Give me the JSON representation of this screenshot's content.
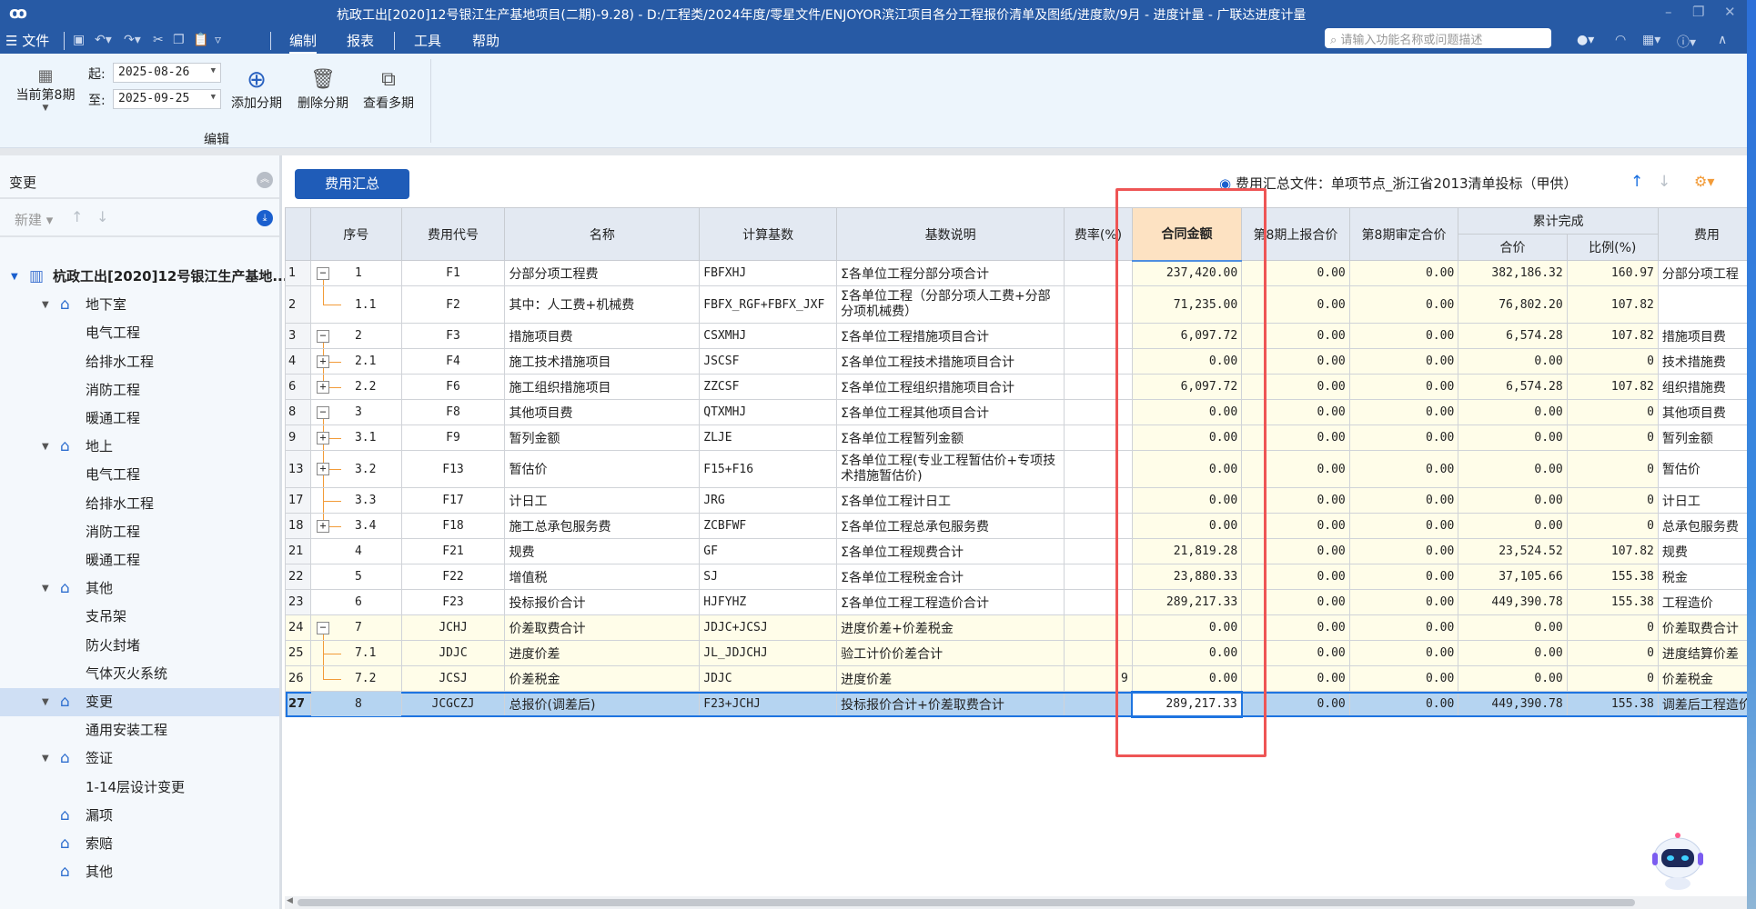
{
  "titlebar": {
    "title": "杭政工出[2020]12号银江生产基地项目(二期)-9.28) - D:/工程类/2024年度/零星文件/ENJOYOR滨江项目各分工程报价清单及图纸/进度款/9月 - 进度计量 - 广联达进度计量",
    "minimize": "–",
    "restore": "❐",
    "close": "✕"
  },
  "menubar": {
    "file": "☰ 文件",
    "tabs": [
      "编制",
      "报表",
      "工具",
      "帮助"
    ],
    "search_placeholder": "请输入功能名称或问题描述"
  },
  "ribbon": {
    "period_label": "当前第8期",
    "start_label": "起:",
    "start_date": "2025-08-26",
    "end_label": "至:",
    "end_date": "2025-09-25",
    "buttons": [
      "添加分期",
      "删除分期",
      "查看多期"
    ],
    "group_label": "编辑"
  },
  "sidebar": {
    "title": "变更",
    "new_label": "新建",
    "items": [
      {
        "label": "杭政工出[2020]12号银江生产基地...",
        "type": "root"
      },
      {
        "label": "地下室",
        "type": "group"
      },
      {
        "label": "电气工程",
        "type": "leaf"
      },
      {
        "label": "给排水工程",
        "type": "leaf"
      },
      {
        "label": "消防工程",
        "type": "leaf"
      },
      {
        "label": "暖通工程",
        "type": "leaf"
      },
      {
        "label": "地上",
        "type": "group"
      },
      {
        "label": "电气工程",
        "type": "leaf"
      },
      {
        "label": "给排水工程",
        "type": "leaf"
      },
      {
        "label": "消防工程",
        "type": "leaf"
      },
      {
        "label": "暖通工程",
        "type": "leaf"
      },
      {
        "label": "其他",
        "type": "group"
      },
      {
        "label": "支吊架",
        "type": "leaf"
      },
      {
        "label": "防火封堵",
        "type": "leaf"
      },
      {
        "label": "气体灭火系统",
        "type": "leaf"
      },
      {
        "label": "变更",
        "type": "group",
        "selected": true
      },
      {
        "label": "通用安装工程",
        "type": "leaf"
      },
      {
        "label": "签证",
        "type": "group"
      },
      {
        "label": "1-14层设计变更",
        "type": "leaf"
      },
      {
        "label": "漏项",
        "type": "single"
      },
      {
        "label": "索赔",
        "type": "single"
      },
      {
        "label": "其他",
        "type": "single"
      }
    ]
  },
  "main": {
    "summary_button": "费用汇总",
    "file_info": "费用汇总文件：单项节点_浙江省2013清单投标（甲供）",
    "headers": {
      "seq": "序号",
      "code": "费用代号",
      "name": "名称",
      "base": "计算基数",
      "desc": "基数说明",
      "rate": "费率(%)",
      "contract": "合同金额",
      "reported": "第8期上报合价",
      "approved": "第8期审定合价",
      "cumulative": "累计完成",
      "cum_total": "合价",
      "cum_ratio": "比例(%)",
      "fee_type": "费用"
    },
    "rows": [
      {
        "rn": "1",
        "seq": "1",
        "exp": "-",
        "code": "F1",
        "name": "分部分项工程费",
        "base": "FBFXHJ",
        "desc": "Σ各单位工程分部分项合计",
        "rate": "",
        "contract": "237,420.00",
        "reported": "0.00",
        "approved": "0.00",
        "cum_total": "382,186.32",
        "cum_ratio": "160.97",
        "fee_type": "分部分项工程"
      },
      {
        "rn": "2",
        "seq": "1.1",
        "branch": "last",
        "code": "F2",
        "name": "其中：人工费+机械费",
        "base": "FBFX_RGF+FBFX_JXF",
        "desc": "Σ各单位工程（分部分项人工费+分部分项机械费）",
        "rate": "",
        "contract": "71,235.00",
        "reported": "0.00",
        "approved": "0.00",
        "cum_total": "76,802.20",
        "cum_ratio": "107.82",
        "fee_type": "",
        "tall": true
      },
      {
        "rn": "3",
        "seq": "2",
        "exp": "-",
        "code": "F3",
        "name": "措施项目费",
        "base": "CSXMHJ",
        "desc": "Σ各单位工程措施项目合计",
        "rate": "",
        "contract": "6,097.72",
        "reported": "0.00",
        "approved": "0.00",
        "cum_total": "6,574.28",
        "cum_ratio": "107.82",
        "fee_type": "措施项目费"
      },
      {
        "rn": "4",
        "seq": "2.1",
        "exp": "+",
        "branch": "mid",
        "code": "F4",
        "name": "施工技术措施项目",
        "base": "JSCSF",
        "desc": "Σ各单位工程技术措施项目合计",
        "rate": "",
        "contract": "0.00",
        "reported": "0.00",
        "approved": "0.00",
        "cum_total": "0.00",
        "cum_ratio": "0",
        "fee_type": "技术措施费"
      },
      {
        "rn": "6",
        "seq": "2.2",
        "exp": "+",
        "branch": "last",
        "code": "F6",
        "name": "施工组织措施项目",
        "base": "ZZCSF",
        "desc": "Σ各单位工程组织措施项目合计",
        "rate": "",
        "contract": "6,097.72",
        "reported": "0.00",
        "approved": "0.00",
        "cum_total": "6,574.28",
        "cum_ratio": "107.82",
        "fee_type": "组织措施费"
      },
      {
        "rn": "8",
        "seq": "3",
        "exp": "-",
        "code": "F8",
        "name": "其他项目费",
        "base": "QTXMHJ",
        "desc": "Σ各单位工程其他项目合计",
        "rate": "",
        "contract": "0.00",
        "reported": "0.00",
        "approved": "0.00",
        "cum_total": "0.00",
        "cum_ratio": "0",
        "fee_type": "其他项目费"
      },
      {
        "rn": "9",
        "seq": "3.1",
        "exp": "+",
        "branch": "mid",
        "code": "F9",
        "name": "暂列金额",
        "base": "ZLJE",
        "desc": "Σ各单位工程暂列金额",
        "rate": "",
        "contract": "0.00",
        "reported": "0.00",
        "approved": "0.00",
        "cum_total": "0.00",
        "cum_ratio": "0",
        "fee_type": "暂列金额"
      },
      {
        "rn": "13",
        "seq": "3.2",
        "exp": "+",
        "branch": "mid",
        "code": "F13",
        "name": "暂估价",
        "base": "F15+F16",
        "desc": "Σ各单位工程(专业工程暂估价+专项技术措施暂估价)",
        "rate": "",
        "contract": "0.00",
        "reported": "0.00",
        "approved": "0.00",
        "cum_total": "0.00",
        "cum_ratio": "0",
        "fee_type": "暂估价",
        "tall": true
      },
      {
        "rn": "17",
        "seq": "3.3",
        "branch": "mid",
        "code": "F17",
        "name": "计日工",
        "base": "JRG",
        "desc": "Σ各单位工程计日工",
        "rate": "",
        "contract": "0.00",
        "reported": "0.00",
        "approved": "0.00",
        "cum_total": "0.00",
        "cum_ratio": "0",
        "fee_type": "计日工"
      },
      {
        "rn": "18",
        "seq": "3.4",
        "exp": "+",
        "branch": "last",
        "code": "F18",
        "name": "施工总承包服务费",
        "base": "ZCBFWF",
        "desc": "Σ各单位工程总承包服务费",
        "rate": "",
        "contract": "0.00",
        "reported": "0.00",
        "approved": "0.00",
        "cum_total": "0.00",
        "cum_ratio": "0",
        "fee_type": "总承包服务费"
      },
      {
        "rn": "21",
        "seq": "4",
        "code": "F21",
        "name": "规费",
        "base": "GF",
        "desc": "Σ各单位工程规费合计",
        "rate": "",
        "contract": "21,819.28",
        "reported": "0.00",
        "approved": "0.00",
        "cum_total": "23,524.52",
        "cum_ratio": "107.82",
        "fee_type": "规费"
      },
      {
        "rn": "22",
        "seq": "5",
        "code": "F22",
        "name": "增值税",
        "base": "SJ",
        "desc": "Σ各单位工程税金合计",
        "rate": "",
        "contract": "23,880.33",
        "reported": "0.00",
        "approved": "0.00",
        "cum_total": "37,105.66",
        "cum_ratio": "155.38",
        "fee_type": "税金"
      },
      {
        "rn": "23",
        "seq": "6",
        "code": "F23",
        "name": "投标报价合计",
        "base": "HJFYHZ",
        "desc": "Σ各单位工程工程造价合计",
        "rate": "",
        "contract": "289,217.33",
        "reported": "0.00",
        "approved": "0.00",
        "cum_total": "449,390.78",
        "cum_ratio": "155.38",
        "fee_type": "工程造价"
      },
      {
        "rn": "24",
        "seq": "7",
        "exp": "-",
        "code": "JCHJ",
        "name": "价差取费合计",
        "base": "JDJC+JCSJ",
        "desc": "进度价差+价差税金",
        "rate": "",
        "contract": "0.00",
        "reported": "0.00",
        "approved": "0.00",
        "cum_total": "0.00",
        "cum_ratio": "0",
        "fee_type": "价差取费合计",
        "yellow": true
      },
      {
        "rn": "25",
        "seq": "7.1",
        "branch": "mid",
        "code": "JDJC",
        "name": "进度价差",
        "base": "JL_JDJCHJ",
        "desc": "验工计价价差合计",
        "rate": "",
        "contract": "0.00",
        "reported": "0.00",
        "approved": "0.00",
        "cum_total": "0.00",
        "cum_ratio": "0",
        "fee_type": "进度结算价差",
        "yellow": true
      },
      {
        "rn": "26",
        "seq": "7.2",
        "branch": "last",
        "code": "JCSJ",
        "name": "价差税金",
        "base": "JDJC",
        "desc": "进度价差",
        "rate": "9",
        "contract": "0.00",
        "reported": "0.00",
        "approved": "0.00",
        "cum_total": "0.00",
        "cum_ratio": "0",
        "fee_type": "价差税金",
        "yellow": true
      },
      {
        "rn": "27",
        "seq": "8",
        "code": "JCGCZJ",
        "name": "总报价(调差后)",
        "base": "F23+JCHJ",
        "desc": "投标报价合计+价差取费合计",
        "rate": "",
        "contract": "289,217.33",
        "reported": "0.00",
        "approved": "0.00",
        "cum_total": "449,390.78",
        "cum_ratio": "155.38",
        "fee_type": "调差后工程造价",
        "selected": true
      }
    ]
  },
  "colors": {
    "titlebar": "#275aa5",
    "highlight_box": "#ee5555",
    "selected_row": "#b5d4f1",
    "header_highlight": "#fde2c2"
  }
}
